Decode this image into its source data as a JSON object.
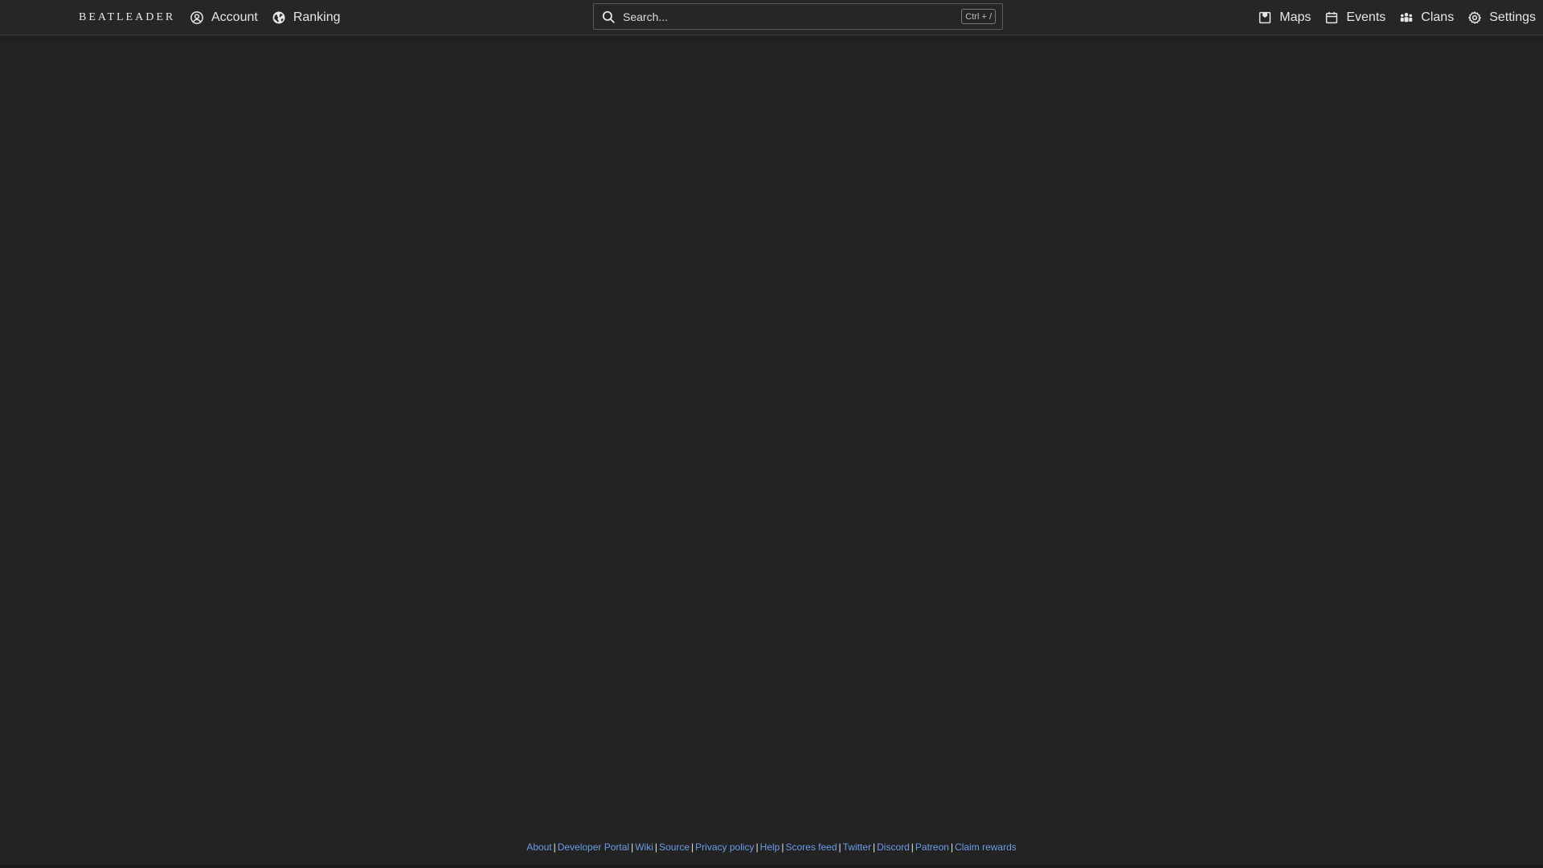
{
  "header": {
    "brand": "BEATLEADER",
    "nav_left": [
      {
        "label": "Account",
        "icon": "user-circle-icon"
      },
      {
        "label": "Ranking",
        "icon": "globe-icon"
      }
    ],
    "search": {
      "placeholder": "Search...",
      "shortcut": "Ctrl + /"
    },
    "nav_right": [
      {
        "label": "Maps",
        "icon": "map-icon"
      },
      {
        "label": "Events",
        "icon": "calendar-icon"
      },
      {
        "label": "Clans",
        "icon": "users-icon"
      },
      {
        "label": "Settings",
        "icon": "gear-icon"
      }
    ]
  },
  "footer": {
    "links": [
      "About",
      "Developer Portal",
      "Wiki",
      "Source",
      "Privacy policy",
      "Help",
      "Scores feed",
      "Twitter",
      "Discord",
      "Patreon",
      "Claim rewards"
    ],
    "separator": "|"
  },
  "colors": {
    "background": "#232323",
    "header": "#262626",
    "link": "#6b9ce8",
    "text": "#e6e6e6"
  }
}
